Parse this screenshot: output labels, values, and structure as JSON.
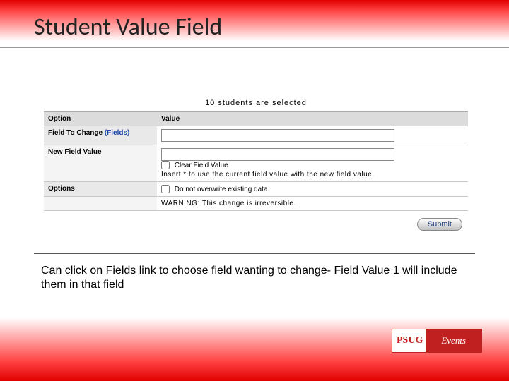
{
  "title": "Student Value Field",
  "form": {
    "selected_text": "10 students are selected",
    "header_option": "Option",
    "header_value": "Value",
    "row_field_label": "Field To Change",
    "fields_link_text": "(Fields)",
    "field_input_value": "",
    "row_newvalue_label": "New Field Value",
    "newvalue_input_value": "",
    "clear_checkbox_label": "Clear Field Value",
    "insert_hint": "Insert * to use the current field value with the new field value.",
    "row_options_label": "Options",
    "overwrite_checkbox_label": "Do not overwrite existing data.",
    "warning_text": "WARNING: This change is irreversible.",
    "submit_label": "Submit"
  },
  "caption": "Can click on Fields link to choose field wanting to change- Field Value 1 will include them in that field",
  "logo": {
    "left": "PS",
    "mid": "U",
    "left2": "G",
    "right": "Events"
  }
}
